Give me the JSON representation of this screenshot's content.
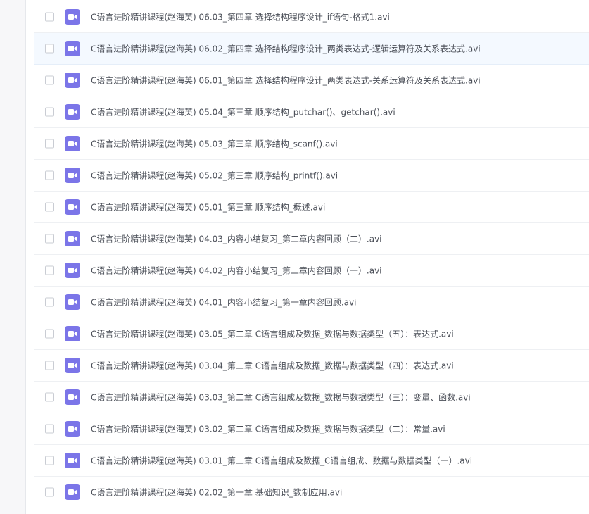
{
  "file_list": {
    "items": [
      {
        "name": "C语言进阶精讲课程(赵海英) 06.03_第四章 选择结构程序设计_if语句-格式1.avi",
        "icon": "video-file-icon"
      },
      {
        "name": "C语言进阶精讲课程(赵海英) 06.02_第四章 选择结构程序设计_两类表达式-逻辑运算符及关系表达式.avi",
        "icon": "video-file-icon"
      },
      {
        "name": "C语言进阶精讲课程(赵海英) 06.01_第四章 选择结构程序设计_两类表达式-关系运算符及关系表达式.avi",
        "icon": "video-file-icon"
      },
      {
        "name": "C语言进阶精讲课程(赵海英) 05.04_第三章 顺序结构_putchar()、getchar().avi",
        "icon": "video-file-icon"
      },
      {
        "name": "C语言进阶精讲课程(赵海英) 05.03_第三章 顺序结构_scanf().avi",
        "icon": "video-file-icon"
      },
      {
        "name": "C语言进阶精讲课程(赵海英) 05.02_第三章 顺序结构_printf().avi",
        "icon": "video-file-icon"
      },
      {
        "name": "C语言进阶精讲课程(赵海英) 05.01_第三章 顺序结构_概述.avi",
        "icon": "video-file-icon"
      },
      {
        "name": "C语言进阶精讲课程(赵海英) 04.03_内容小结复习_第二章内容回顾（二）.avi",
        "icon": "video-file-icon"
      },
      {
        "name": "C语言进阶精讲课程(赵海英) 04.02_内容小结复习_第二章内容回顾（一）.avi",
        "icon": "video-file-icon"
      },
      {
        "name": "C语言进阶精讲课程(赵海英) 04.01_内容小结复习_第一章内容回顾.avi",
        "icon": "video-file-icon"
      },
      {
        "name": "C语言进阶精讲课程(赵海英) 03.05_第二章 C语言组成及数据_数据与数据类型（五）：表达式.avi",
        "icon": "video-file-icon"
      },
      {
        "name": "C语言进阶精讲课程(赵海英) 03.04_第二章 C语言组成及数据_数据与数据类型（四）：表达式.avi",
        "icon": "video-file-icon"
      },
      {
        "name": "C语言进阶精讲课程(赵海英) 03.03_第二章 C语言组成及数据_数据与数据类型（三）：变量、函数.avi",
        "icon": "video-file-icon"
      },
      {
        "name": "C语言进阶精讲课程(赵海英) 03.02_第二章 C语言组成及数据_数据与数据类型（二）：常量.avi",
        "icon": "video-file-icon"
      },
      {
        "name": "C语言进阶精讲课程(赵海英) 03.01_第二章 C语言组成及数据_C语言组成、数据与数据类型（一）.avi",
        "icon": "video-file-icon"
      },
      {
        "name": "C语言进阶精讲课程(赵海英) 02.02_第一章 基础知识_数制应用.avi",
        "icon": "video-file-icon"
      }
    ]
  },
  "colors": {
    "icon_background": "#7b75e8",
    "row_hover_background": "#f4f9ff",
    "text": "#4b4f58"
  }
}
